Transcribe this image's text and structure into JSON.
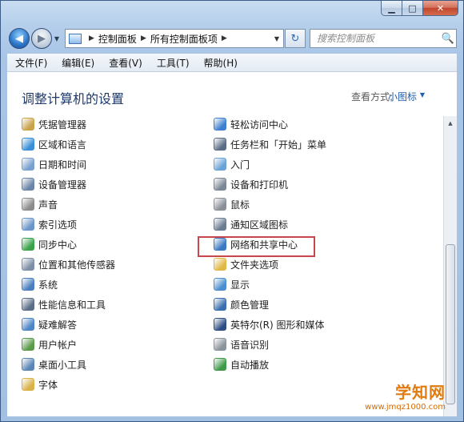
{
  "window": {
    "caption_min": "▁",
    "caption_max": "□",
    "caption_close": "✕"
  },
  "navigation": {
    "back_glyph": "◀",
    "forward_glyph": "▶",
    "breadcrumbs": [
      "控制面板",
      "所有控制面板项"
    ],
    "refresh_glyph": "↻",
    "search_placeholder": "搜索控制面板",
    "search_icon": "🔍"
  },
  "menu": [
    "文件(F)",
    "编辑(E)",
    "查看(V)",
    "工具(T)",
    "帮助(H)"
  ],
  "content": {
    "heading": "调整计算机的设置",
    "view_by_label": "查看方式:",
    "view_by_value": "小图标"
  },
  "items_left": [
    {
      "label": "凭据管理器",
      "icon": "credential-manager-icon",
      "color": "#c9a24a"
    },
    {
      "label": "区域和语言",
      "icon": "region-language-icon",
      "color": "#3a8fd6"
    },
    {
      "label": "日期和时间",
      "icon": "date-time-icon",
      "color": "#7aa0cf"
    },
    {
      "label": "设备管理器",
      "icon": "device-manager-icon",
      "color": "#6b86a8"
    },
    {
      "label": "声音",
      "icon": "sound-icon",
      "color": "#8c8c8c"
    },
    {
      "label": "索引选项",
      "icon": "indexing-options-icon",
      "color": "#6c96c8"
    },
    {
      "label": "同步中心",
      "icon": "sync-center-icon",
      "color": "#3aa24a"
    },
    {
      "label": "位置和其他传感器",
      "icon": "location-sensors-icon",
      "color": "#7d8fa6"
    },
    {
      "label": "系统",
      "icon": "system-icon",
      "color": "#4a7fc0"
    },
    {
      "label": "性能信息和工具",
      "icon": "performance-icon",
      "color": "#5a6e88"
    },
    {
      "label": "疑难解答",
      "icon": "troubleshooting-icon",
      "color": "#4f86c6"
    },
    {
      "label": "用户帐户",
      "icon": "user-accounts-icon",
      "color": "#5c9a4c"
    },
    {
      "label": "桌面小工具",
      "icon": "desktop-gadgets-icon",
      "color": "#5b86b6"
    },
    {
      "label": "字体",
      "icon": "fonts-icon",
      "color": "#d9b24a"
    }
  ],
  "items_right": [
    {
      "label": "轻松访问中心",
      "icon": "ease-of-access-icon",
      "color": "#3f7fcf"
    },
    {
      "label": "任务栏和「开始」菜单",
      "icon": "taskbar-start-menu-icon",
      "color": "#5a6d86"
    },
    {
      "label": "入门",
      "icon": "getting-started-icon",
      "color": "#6aa3d8"
    },
    {
      "label": "设备和打印机",
      "icon": "devices-printers-icon",
      "color": "#7b8796"
    },
    {
      "label": "鼠标",
      "icon": "mouse-icon",
      "color": "#8a8f98"
    },
    {
      "label": "通知区域图标",
      "icon": "notification-area-icon",
      "color": "#6b7c90"
    },
    {
      "label": "网络和共享中心",
      "icon": "network-sharing-icon",
      "color": "#3a78c2"
    },
    {
      "label": "文件夹选项",
      "icon": "folder-options-icon",
      "color": "#e0b848"
    },
    {
      "label": "显示",
      "icon": "display-icon",
      "color": "#4b8fd0"
    },
    {
      "label": "颜色管理",
      "icon": "color-management-icon",
      "color": "#3b6fb0"
    },
    {
      "label": "英特尔(R) 图形和媒体",
      "icon": "intel-graphics-icon",
      "color": "#2d4f86"
    },
    {
      "label": "语音识别",
      "icon": "speech-recognition-icon",
      "color": "#8b939c"
    },
    {
      "label": "自动播放",
      "icon": "autoplay-icon",
      "color": "#3f9b4a"
    }
  ],
  "watermark": {
    "title": "学知网",
    "url": "www.jmqz1000.com"
  }
}
